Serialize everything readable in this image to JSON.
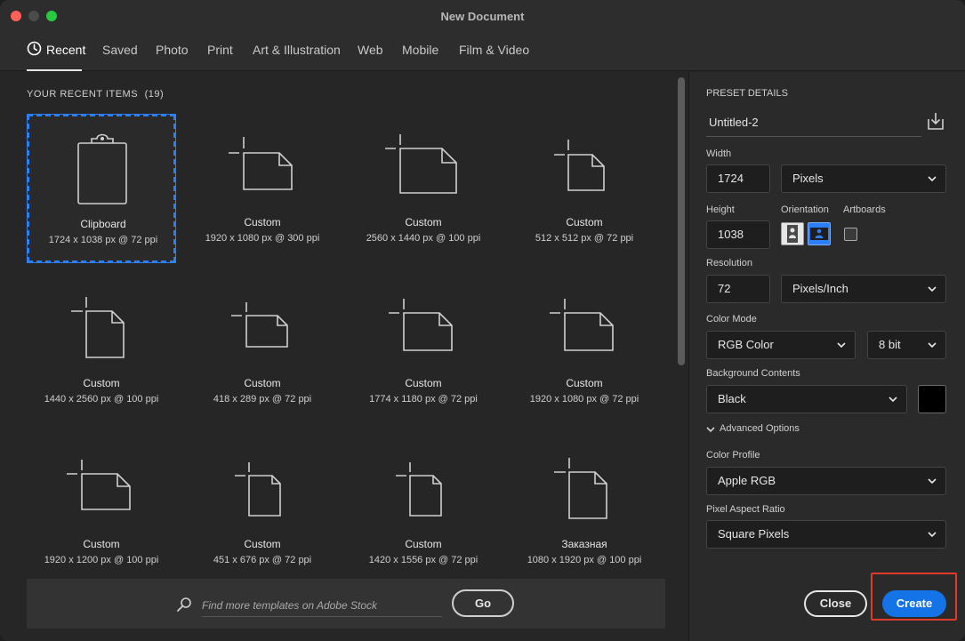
{
  "window": {
    "title": "New Document"
  },
  "tabs": [
    {
      "label": "Recent",
      "active": true
    },
    {
      "label": "Saved"
    },
    {
      "label": "Photo"
    },
    {
      "label": "Print"
    },
    {
      "label": "Art & Illustration"
    },
    {
      "label": "Web"
    },
    {
      "label": "Mobile"
    },
    {
      "label": "Film & Video"
    }
  ],
  "recent": {
    "heading": "YOUR RECENT ITEMS",
    "count": "(19)",
    "items": [
      {
        "name": "Clipboard",
        "spec": "1724 x 1038 px @ 72 ppi",
        "icon": "clipboard-icon",
        "selected": true
      },
      {
        "name": "Custom",
        "spec": "1920 x 1080 px @ 300 ppi",
        "icon": "landscape-document-icon"
      },
      {
        "name": "Custom",
        "spec": "2560 x 1440 px @ 100 ppi",
        "icon": "landscape-document-icon"
      },
      {
        "name": "Custom",
        "spec": "512 x 512 px @ 72 ppi",
        "icon": "square-document-icon"
      },
      {
        "name": "Custom",
        "spec": "1440 x 2560 px @ 100 ppi",
        "icon": "portrait-document-icon"
      },
      {
        "name": "Custom",
        "spec": "418 x 289 px @ 72 ppi",
        "icon": "landscape-document-icon"
      },
      {
        "name": "Custom",
        "spec": "1774 x 1180 px @ 72 ppi",
        "icon": "landscape-document-icon"
      },
      {
        "name": "Custom",
        "spec": "1920 x 1080 px @ 72 ppi",
        "icon": "landscape-document-icon"
      },
      {
        "name": "Custom",
        "spec": "1920 x 1200 px @ 100 ppi",
        "icon": "landscape-document-icon"
      },
      {
        "name": "Custom",
        "spec": "451 x 676 px @ 72 ppi",
        "icon": "portrait-document-icon"
      },
      {
        "name": "Custom",
        "spec": "1420 x 1556 px @ 72 ppi",
        "icon": "portrait-document-icon"
      },
      {
        "name": "Заказная",
        "spec": "1080 x 1920 px @ 100 ppi",
        "icon": "portrait-document-icon"
      }
    ]
  },
  "search": {
    "placeholder": "Find more templates on Adobe Stock",
    "go_label": "Go"
  },
  "preset": {
    "heading": "PRESET DETAILS",
    "name": "Untitled-2",
    "width_label": "Width",
    "width_value": "1724",
    "width_unit": "Pixels",
    "height_label": "Height",
    "height_value": "1038",
    "orientation_label": "Orientation",
    "artboards_label": "Artboards",
    "resolution_label": "Resolution",
    "resolution_value": "72",
    "resolution_unit": "Pixels/Inch",
    "color_mode_label": "Color Mode",
    "color_mode_value": "RGB Color",
    "bit_depth_value": "8 bit",
    "background_label": "Background Contents",
    "background_value": "Black",
    "background_color": "#000000",
    "advanced_label": "Advanced Options",
    "color_profile_label": "Color Profile",
    "color_profile_value": "Apple RGB",
    "aspect_label": "Pixel Aspect Ratio",
    "aspect_value": "Square Pixels"
  },
  "actions": {
    "close_label": "Close",
    "create_label": "Create"
  },
  "colors": {
    "accent": "#1473e6",
    "selection": "#2d7ff9",
    "highlight": "#e03a2b"
  }
}
